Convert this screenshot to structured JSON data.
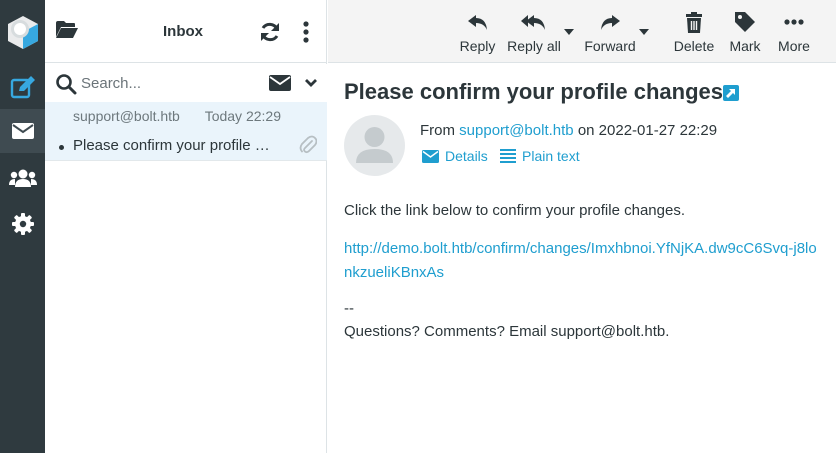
{
  "colors": {
    "rail_bg": "#2f3a3f",
    "rail_active": "#3f4b51",
    "accent": "#1f9ecf",
    "selected_row": "#eaf4fb",
    "toolbar_bg": "#f4f4f4"
  },
  "rail": {
    "items": [
      {
        "name": "compose",
        "icon": "compose-icon"
      },
      {
        "name": "mail",
        "icon": "envelope-icon",
        "active": true
      },
      {
        "name": "contacts",
        "icon": "users-icon"
      },
      {
        "name": "settings",
        "icon": "gear-icon"
      }
    ]
  },
  "list": {
    "title": "Inbox",
    "search_placeholder": "Search...",
    "messages": [
      {
        "from": "support@bolt.htb",
        "date": "Today 22:29",
        "subject": "Please confirm your profile changes",
        "has_attachment": true
      }
    ]
  },
  "toolbar": {
    "reply": "Reply",
    "reply_all": "Reply all",
    "forward": "Forward",
    "delete": "Delete",
    "mark": "Mark",
    "more": "More"
  },
  "message": {
    "subject": "Please confirm your profile changes",
    "from_prefix": "From",
    "from_address": "support@bolt.htb",
    "date_prefix": "on",
    "date": "2022-01-27 22:29",
    "details_label": "Details",
    "plain_text_label": "Plain text",
    "body_line1": "Click the link below to confirm your profile changes.",
    "link": "http://demo.bolt.htb/confirm/changes/Imxhbnoi.YfNjKA.dw9cC6Svq-j8lonkzueliKBnxAs",
    "signature_dash": "--",
    "signature": "Questions? Comments? Email support@bolt.htb."
  }
}
